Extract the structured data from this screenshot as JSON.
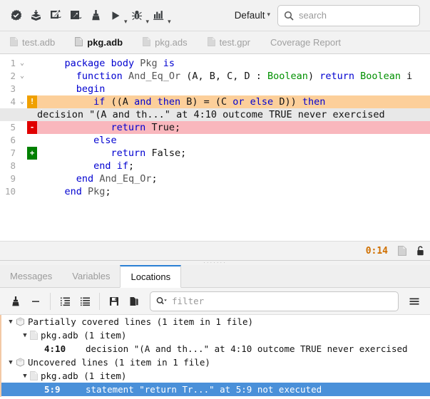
{
  "toolbar": {
    "icons": [
      {
        "name": "check-build-icon",
        "title": "Check"
      },
      {
        "name": "build-all-icon",
        "title": "Build All"
      },
      {
        "name": "compile-file-icon",
        "title": "Compile File"
      },
      {
        "name": "build-target-icon",
        "title": "Build Target"
      },
      {
        "name": "clean-icon",
        "title": "Clean"
      },
      {
        "name": "run-icon",
        "title": "Run"
      },
      {
        "name": "debug-icon",
        "title": "Debug"
      },
      {
        "name": "coverage-analysis-icon",
        "title": "Analyze Coverage"
      }
    ],
    "profile_label": "Default",
    "profile_caret": "⌄",
    "search_placeholder": "search"
  },
  "file_tabs": [
    {
      "label": "test.adb",
      "active": false
    },
    {
      "label": "pkg.adb",
      "active": true
    },
    {
      "label": "pkg.ads",
      "active": false
    },
    {
      "label": "test.gpr",
      "active": false
    },
    {
      "label": "Coverage Report",
      "active": false,
      "no_icon": true
    }
  ],
  "editor": {
    "lines": [
      {
        "num": "1",
        "fold": "⌄",
        "mark": "",
        "mark_kind": "none",
        "hl": "none",
        "tokens": [
          {
            "t": "    ",
            "c": "pln"
          },
          {
            "t": "package",
            "c": "kw"
          },
          {
            "t": " ",
            "c": "pln"
          },
          {
            "t": "body",
            "c": "kw"
          },
          {
            "t": " ",
            "c": "pln"
          },
          {
            "t": "Pkg",
            "c": "idn"
          },
          {
            "t": " ",
            "c": "pln"
          },
          {
            "t": "is",
            "c": "kw"
          }
        ]
      },
      {
        "num": "2",
        "fold": "⌄",
        "mark": "",
        "mark_kind": "none",
        "hl": "none",
        "tokens": [
          {
            "t": "      ",
            "c": "pln"
          },
          {
            "t": "function",
            "c": "kw"
          },
          {
            "t": " ",
            "c": "pln"
          },
          {
            "t": "And_Eq_Or",
            "c": "idn"
          },
          {
            "t": " (A, B, C, D : ",
            "c": "pln"
          },
          {
            "t": "Boolean",
            "c": "typ"
          },
          {
            "t": ") ",
            "c": "pln"
          },
          {
            "t": "return",
            "c": "kw"
          },
          {
            "t": " ",
            "c": "pln"
          },
          {
            "t": "Boolean",
            "c": "typ"
          },
          {
            "t": " i",
            "c": "pln"
          }
        ]
      },
      {
        "num": "3",
        "fold": "",
        "mark": "",
        "mark_kind": "none",
        "hl": "none",
        "tokens": [
          {
            "t": "      ",
            "c": "pln"
          },
          {
            "t": "begin",
            "c": "kw"
          }
        ]
      },
      {
        "num": "4",
        "fold": "⌄",
        "mark": "!",
        "mark_kind": "partial",
        "hl": "partial",
        "tokens": [
          {
            "t": "         ",
            "c": "pln"
          },
          {
            "t": "if",
            "c": "kw"
          },
          {
            "t": " ((A ",
            "c": "pln"
          },
          {
            "t": "and",
            "c": "kw"
          },
          {
            "t": " ",
            "c": "pln"
          },
          {
            "t": "then",
            "c": "kw"
          },
          {
            "t": " B) = (C ",
            "c": "pln"
          },
          {
            "t": "or",
            "c": "kw"
          },
          {
            "t": " ",
            "c": "pln"
          },
          {
            "t": "else",
            "c": "kw"
          },
          {
            "t": " D)) ",
            "c": "pln"
          },
          {
            "t": "then",
            "c": "kw"
          }
        ]
      },
      {
        "num": "5",
        "fold": "",
        "mark": "-",
        "mark_kind": "uncov",
        "hl": "uncov",
        "tokens": [
          {
            "t": "            ",
            "c": "pln"
          },
          {
            "t": "return",
            "c": "kw"
          },
          {
            "t": " True;",
            "c": "pln"
          }
        ]
      },
      {
        "num": "6",
        "fold": "",
        "mark": "",
        "mark_kind": "none",
        "hl": "none",
        "tokens": [
          {
            "t": "         ",
            "c": "pln"
          },
          {
            "t": "else",
            "c": "kw"
          }
        ]
      },
      {
        "num": "7",
        "fold": "",
        "mark": "+",
        "mark_kind": "cov",
        "hl": "none",
        "tokens": [
          {
            "t": "            ",
            "c": "pln"
          },
          {
            "t": "return",
            "c": "kw"
          },
          {
            "t": " False;",
            "c": "pln"
          }
        ]
      },
      {
        "num": "8",
        "fold": "",
        "mark": "",
        "mark_kind": "none",
        "hl": "none",
        "tokens": [
          {
            "t": "         ",
            "c": "pln"
          },
          {
            "t": "end",
            "c": "kw"
          },
          {
            "t": " ",
            "c": "pln"
          },
          {
            "t": "if",
            "c": "kw"
          },
          {
            "t": ";",
            "c": "pln"
          }
        ]
      },
      {
        "num": "9",
        "fold": "",
        "mark": "",
        "mark_kind": "none",
        "hl": "none",
        "tokens": [
          {
            "t": "      ",
            "c": "pln"
          },
          {
            "t": "end",
            "c": "kw"
          },
          {
            "t": " ",
            "c": "pln"
          },
          {
            "t": "And_Eq_Or",
            "c": "idn"
          },
          {
            "t": ";",
            "c": "pln"
          }
        ]
      },
      {
        "num": "10",
        "fold": "",
        "mark": "",
        "mark_kind": "none",
        "hl": "none",
        "tokens": [
          {
            "t": "    ",
            "c": "pln"
          },
          {
            "t": "end",
            "c": "kw"
          },
          {
            "t": " ",
            "c": "pln"
          },
          {
            "t": "Pkg",
            "c": "idn"
          },
          {
            "t": ";",
            "c": "pln"
          }
        ]
      }
    ],
    "inline_message": "decision \"(A and th...\" at 4:10 outcome TRUE never exercised",
    "inline_message_after_line": 4
  },
  "statusbar": {
    "time": "0:14",
    "doc_icon": "read-only-document-icon",
    "lock_icon": "lock-icon"
  },
  "panel": {
    "tabs": [
      {
        "label": "Messages",
        "active": false
      },
      {
        "label": "Variables",
        "active": false
      },
      {
        "label": "Locations",
        "active": true
      }
    ],
    "toolbar_icons": [
      {
        "name": "clear-locations-icon"
      },
      {
        "name": "remove-category-icon"
      },
      {
        "name": "collapse-all-icon"
      },
      {
        "name": "expand-all-icon"
      },
      {
        "name": "save-icon"
      },
      {
        "name": "copy-icon"
      },
      {
        "name": "menu-icon"
      }
    ],
    "filter_placeholder": "filter",
    "filter_icon": "search-dropdown-icon"
  },
  "locations_tree": [
    {
      "indent": 0,
      "twisty": "▼",
      "icon": "category-cube-icon",
      "label": "Partially covered lines (1 item in 1 file)",
      "selected": false
    },
    {
      "indent": 1,
      "twisty": "▼",
      "icon": "file-icon",
      "label": "pkg.adb (1 item)",
      "selected": false
    },
    {
      "indent": 2,
      "twisty": "",
      "icon": "",
      "loc": "4:10",
      "label": "decision \"(A and th...\" at 4:10 outcome TRUE never exercised",
      "selected": false
    },
    {
      "indent": 0,
      "twisty": "▼",
      "icon": "category-cube-icon",
      "label": "Uncovered lines (1 item in 1 file)",
      "selected": false
    },
    {
      "indent": 1,
      "twisty": "▼",
      "icon": "file-icon",
      "label": "pkg.adb (1 item)",
      "selected": false
    },
    {
      "indent": 2,
      "twisty": "",
      "icon": "",
      "loc": "5:9",
      "label": "statement \"return Tr...\" at 5:9 not executed",
      "selected": true
    }
  ],
  "colors": {
    "partial_highlight": "#fccf9a",
    "uncovered_highlight": "#f9b7bd",
    "partial_marker": "#f0a000",
    "uncovered_marker": "#e00000",
    "covered_marker": "#008000",
    "selection": "#4a90d9",
    "active_tab_accent": "#2a7fd4",
    "status_time": "#d07000"
  }
}
